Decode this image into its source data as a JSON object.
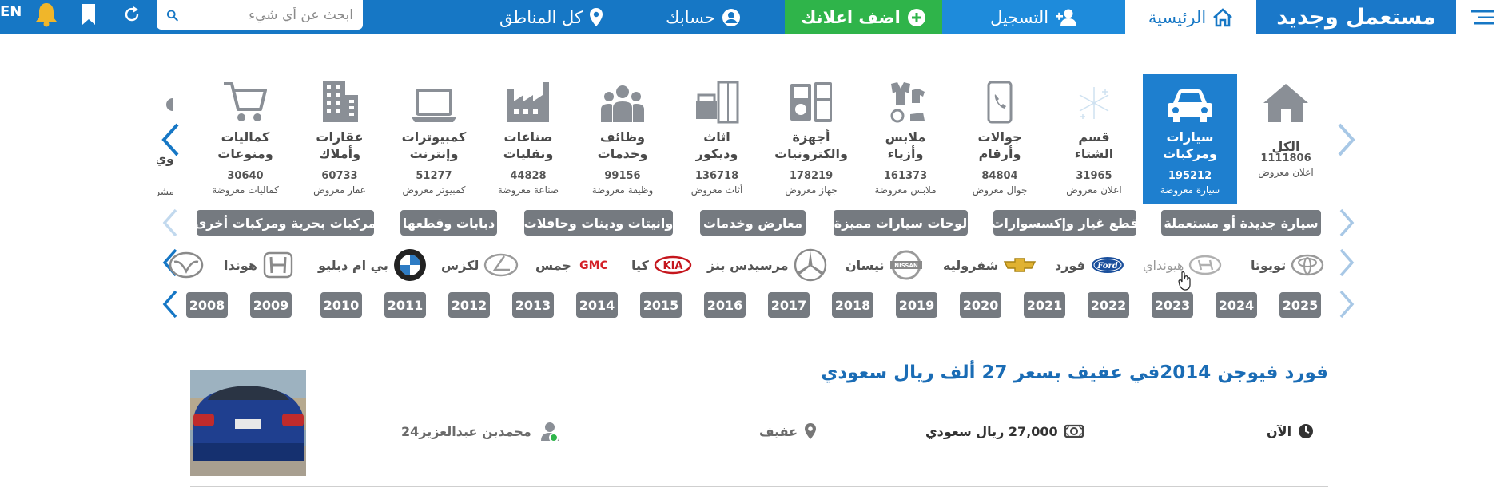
{
  "nav": {
    "logo": "مستعمل وجديد",
    "home": "الرئيسية",
    "register": "التسجيل",
    "add_ad": "اضف اعلانك",
    "account": "حسابك",
    "regions": "كل المناطق",
    "search_placeholder": "ابحث عن أي شيء",
    "lang": "EN"
  },
  "categories": [
    {
      "label1": "الكل",
      "label2": "",
      "count": "1111806",
      "unit": "اعلان معروض",
      "icon": "house-icon"
    },
    {
      "label1": "سيارات",
      "label2": "ومركبات",
      "count": "195212",
      "unit": "سيارة معروضة",
      "icon": "car-icon",
      "active": true
    },
    {
      "label1": "قسم",
      "label2": "الشتاء",
      "count": "31965",
      "unit": "اعلان معروض",
      "icon": "snowflake-icon"
    },
    {
      "label1": "جوالات",
      "label2": "وأرقام",
      "count": "84804",
      "unit": "جوال معروض",
      "icon": "phone-icon"
    },
    {
      "label1": "ملابس",
      "label2": "وأزياء",
      "count": "161373",
      "unit": "ملابس معروضة",
      "icon": "clothes-icon"
    },
    {
      "label1": "أجهزة",
      "label2": "والكترونيات",
      "count": "178219",
      "unit": "جهاز معروض",
      "icon": "appliances-icon"
    },
    {
      "label1": "اثاث",
      "label2": "وديكور",
      "count": "136718",
      "unit": "أثاث معروض",
      "icon": "furniture-icon"
    },
    {
      "label1": "وظائف",
      "label2": "وخدمات",
      "count": "99156",
      "unit": "وظيفة معروضة",
      "icon": "people-icon"
    },
    {
      "label1": "صناعات",
      "label2": "ونقليات",
      "count": "44828",
      "unit": "صناعة معروضة",
      "icon": "factory-icon"
    },
    {
      "label1": "كمبيوترات",
      "label2": "وإنترنت",
      "count": "51277",
      "unit": "كمبيوتر معروض",
      "icon": "laptop-icon"
    },
    {
      "label1": "عقارات",
      "label2": "وأملاك",
      "count": "60733",
      "unit": "عقار معروض",
      "icon": "building-icon"
    },
    {
      "label1": "كماليات",
      "label2": "ومنوعات",
      "count": "30640",
      "unit": "كماليات معروضة",
      "icon": "cart-icon"
    },
    {
      "label1": "",
      "label2": "وي",
      "count": "",
      "unit": "مشر",
      "icon": "partial-icon"
    }
  ],
  "subcategories": [
    "سيارة جديدة أو مستعملة",
    "قطع غيار وإكسسوارات",
    "لوحات سيارات مميزة",
    "معارض وخدمات",
    "وانيتات ودينات وحافلات",
    "دبابات وقطعها",
    "مركبات بحرية ومركبات أخرى"
  ],
  "brands": [
    {
      "name": "تويوتا",
      "icon": "toyota-logo-icon"
    },
    {
      "name": "هيونداي",
      "icon": "hyundai-logo-icon"
    },
    {
      "name": "فورد",
      "icon": "ford-logo-icon"
    },
    {
      "name": "شفروليه",
      "icon": "chevrolet-logo-icon"
    },
    {
      "name": "نيسان",
      "icon": "nissan-logo-icon"
    },
    {
      "name": "مرسيدس بنز",
      "icon": "mercedes-logo-icon"
    },
    {
      "name": "كيا",
      "icon": "kia-logo-icon"
    },
    {
      "name": "جمس",
      "icon": "gmc-logo-icon"
    },
    {
      "name": "لكزس",
      "icon": "lexus-logo-icon"
    },
    {
      "name": "بي ام دبليو",
      "icon": "bmw-logo-icon"
    },
    {
      "name": "هوندا",
      "icon": "honda-logo-icon"
    },
    {
      "name": "",
      "icon": "mazda-logo-icon"
    }
  ],
  "years": [
    "2025",
    "2024",
    "2023",
    "2022",
    "2021",
    "2020",
    "2019",
    "2018",
    "2017",
    "2016",
    "2015",
    "2014",
    "2013",
    "2012",
    "2011",
    "2010",
    "2009",
    "2008"
  ],
  "listing": {
    "title": "فورد فيوجن 2014في عفيف بسعر 27 ألف ريال سعودي",
    "time": "الآن",
    "price": "27,000 ريال سعودي",
    "city": "عفيف",
    "user": "محمدبن عبدالعزيز24"
  },
  "colors": {
    "nav_blue": "#1677c5",
    "add_green": "#2fb44a",
    "chip_gray": "#757a80",
    "title_blue": "#1a6cb5",
    "active_blue": "#1e7fcf"
  }
}
